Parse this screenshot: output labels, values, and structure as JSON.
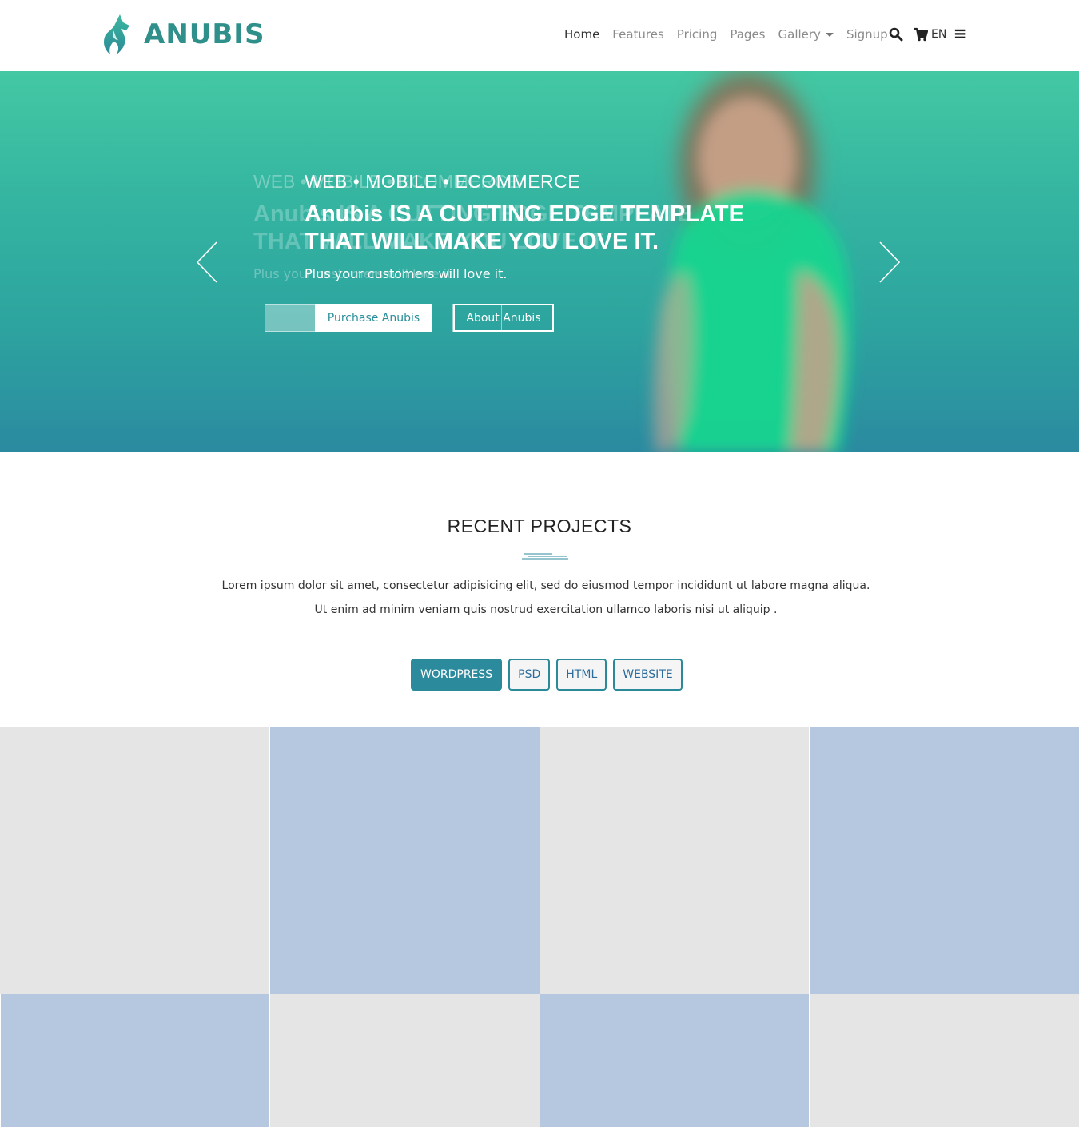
{
  "brand": {
    "name": "ANUBIS",
    "color": "#2f8f8a"
  },
  "nav": {
    "items": [
      {
        "label": "Home",
        "active": true
      },
      {
        "label": "Features",
        "active": false
      },
      {
        "label": "Pricing",
        "active": false
      },
      {
        "label": "Pages",
        "active": false
      },
      {
        "label": "Gallery",
        "active": false,
        "dropdown": true
      },
      {
        "label": "Signup",
        "active": false
      }
    ],
    "icons": [
      "search-icon",
      "cart-icon",
      "menu-icon"
    ],
    "language": "EN"
  },
  "hero": {
    "subtitle": "WEB • MOBILE • ECOMMERCE",
    "title_line1": "Anubis IS A CUTTING EDGE TEMPLATE",
    "title_line2": "THAT WILL MAKE YOU LOVE IT.",
    "text": "Plus your customers will love it.",
    "primary_button": "Purchase Anubis",
    "secondary_button": "About Anubis",
    "gradient_top": "#43c8a3",
    "gradient_bottom": "#2b8aa0"
  },
  "projects": {
    "title": "RECENT PROJECTS",
    "text_line1": "Lorem ipsum dolor sit amet, consectetur adipisicing elit, sed do eiusmod tempor incididunt ut labore magna aliqua.",
    "text_line2": "Ut enim ad minim veniam quis nostrud exercitation ullamco laboris nisi ut aliquip .",
    "filters": [
      {
        "label": "WORDPRESS",
        "active": true
      },
      {
        "label": "PSD",
        "active": false
      },
      {
        "label": "HTML",
        "active": false
      },
      {
        "label": "WEBSITE",
        "active": false
      }
    ],
    "accent": "#2b8a9c",
    "tile_colors": [
      "#e5e5e5",
      "#b5c8e0"
    ]
  }
}
